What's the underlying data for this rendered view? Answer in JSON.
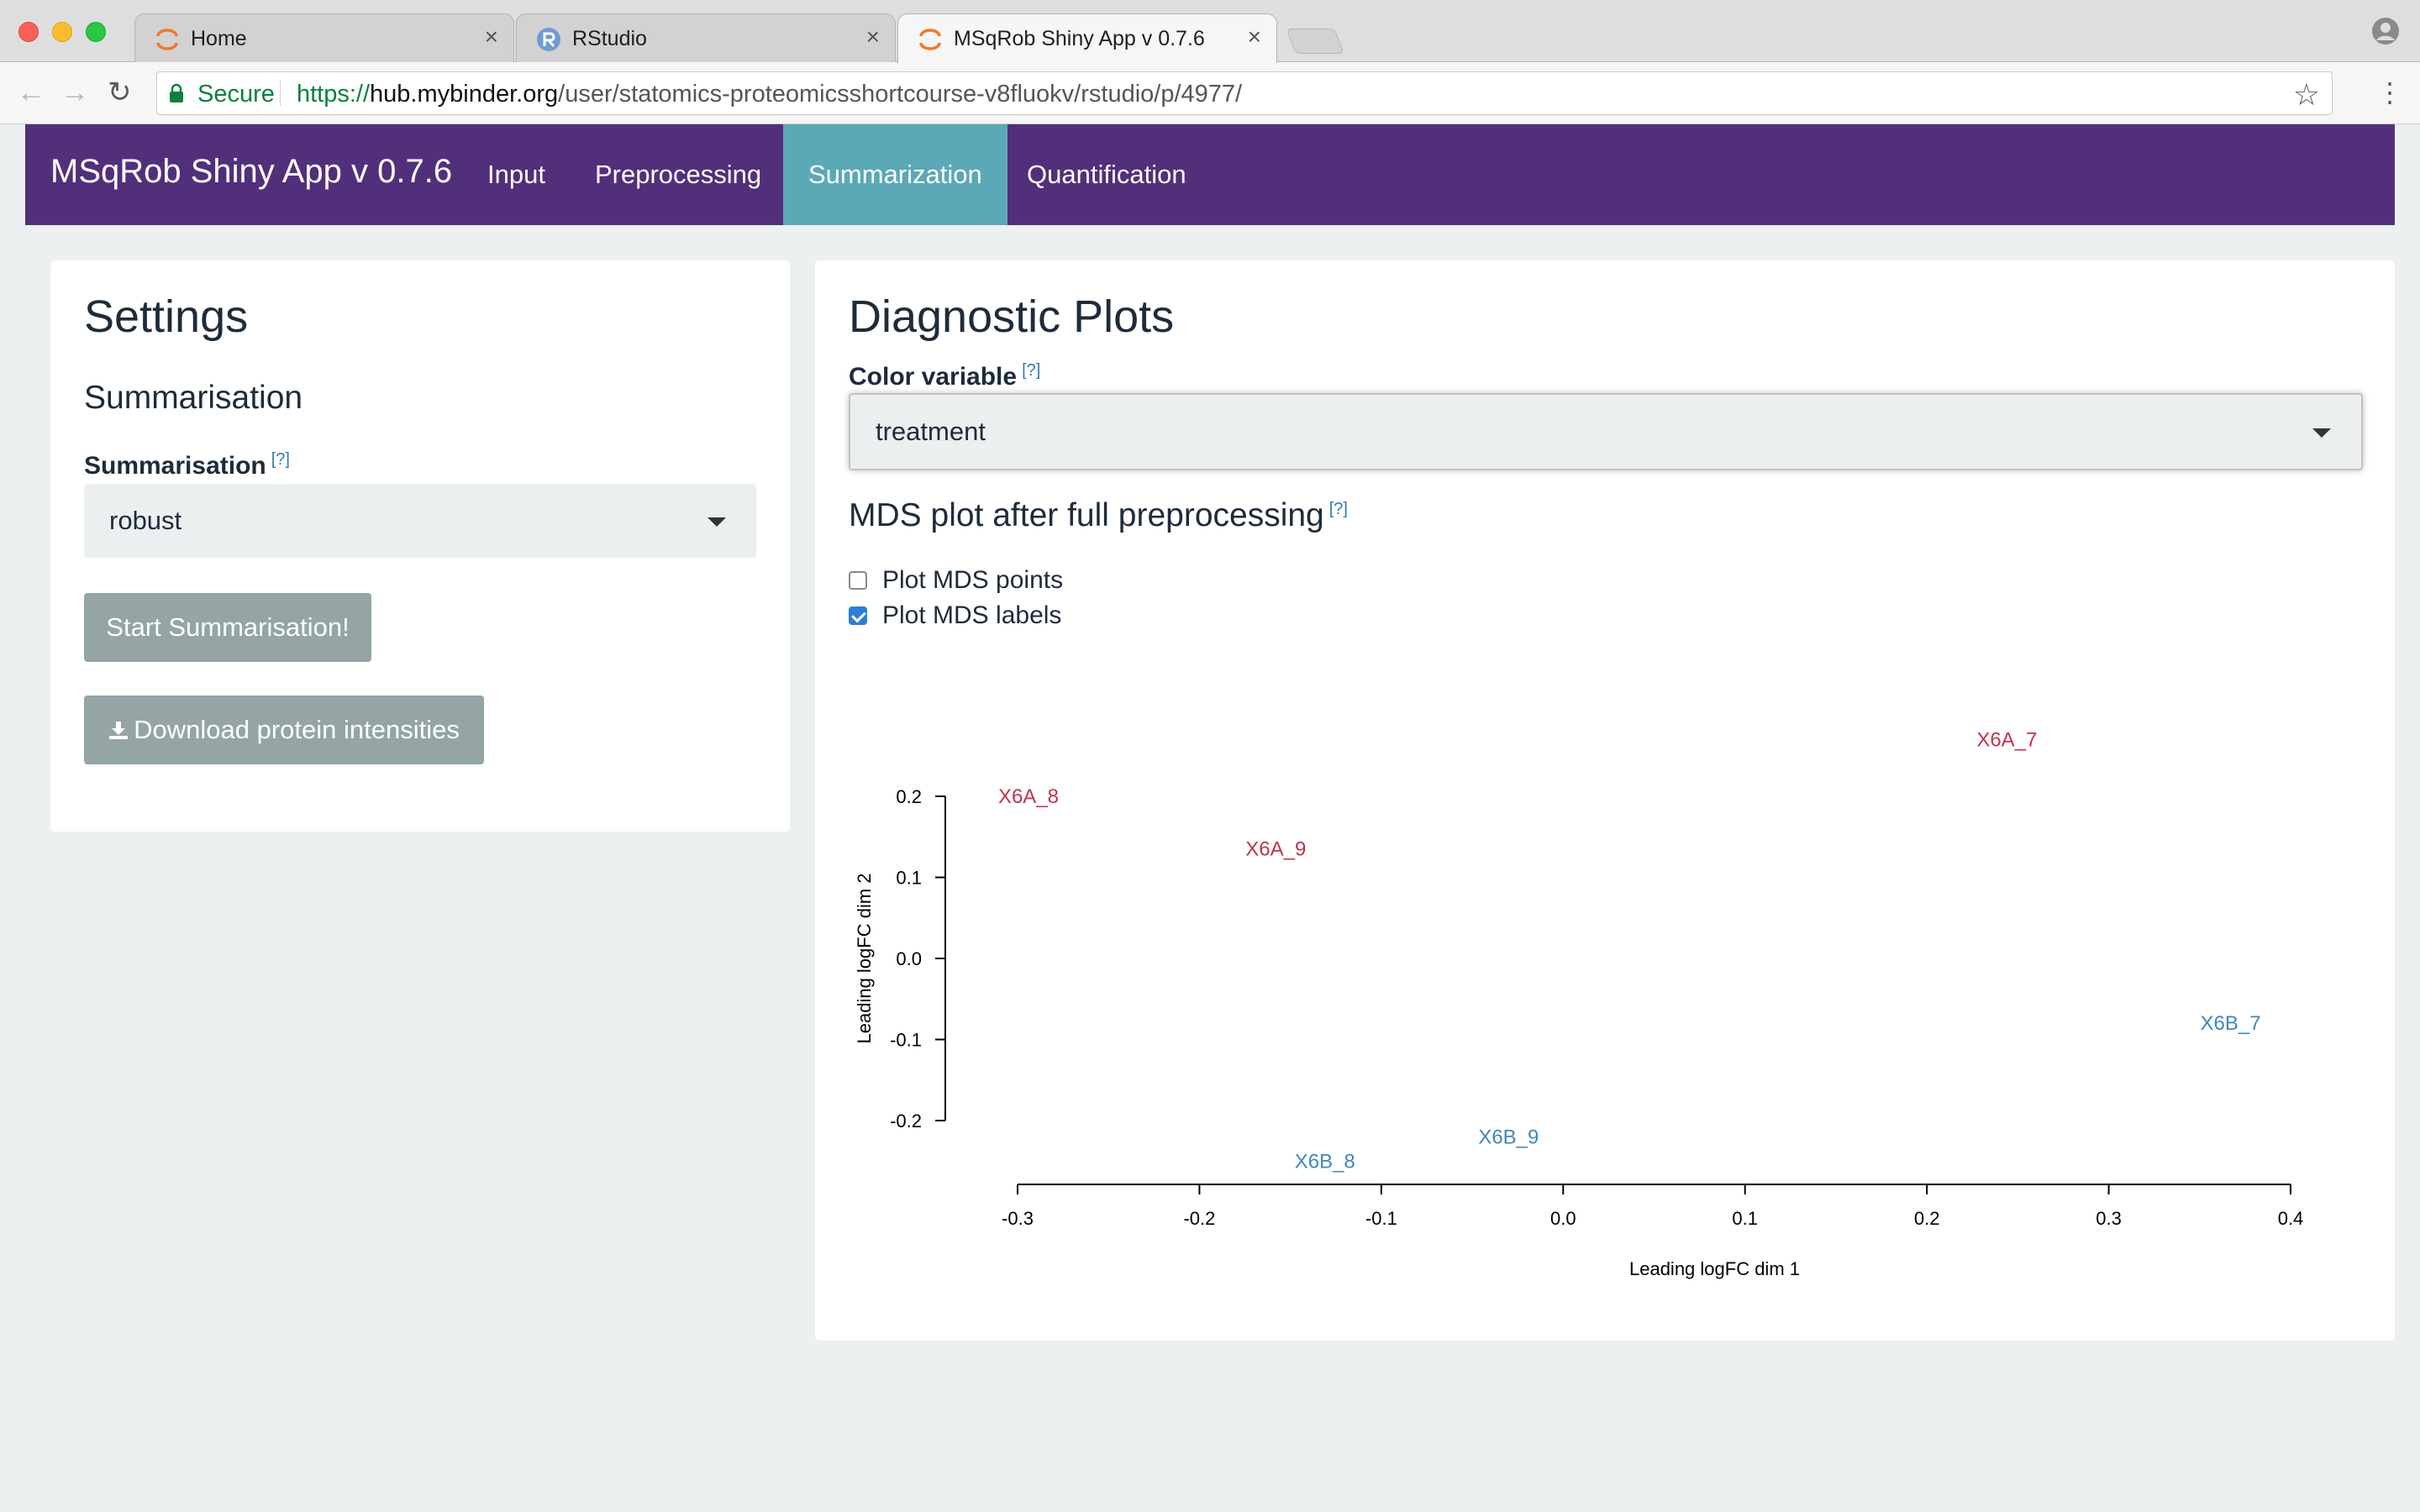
{
  "browser": {
    "tabs": [
      {
        "title": "Home",
        "icon": "jupyter-icon"
      },
      {
        "title": "RStudio",
        "icon": "rstudio-icon"
      },
      {
        "title": "MSqRob Shiny App v 0.7.6",
        "icon": "jupyter-icon",
        "active": true
      }
    ],
    "close_glyph": "×",
    "secure_label": "Secure",
    "url_scheme": "https://",
    "url_host": "hub.mybinder.org",
    "url_path": "/user/statomics-proteomicsshortcourse-v8fluokv/rstudio/p/4977/"
  },
  "navbar": {
    "brand": "MSqRob Shiny App v 0.7.6",
    "items": [
      "Input",
      "Preprocessing",
      "Summarization",
      "Quantification"
    ],
    "active": "Summarization"
  },
  "settings": {
    "title": "Settings",
    "section": "Summarisation",
    "summ_label": "Summarisation",
    "summ_value": "robust",
    "start_button": "Start Summarisation!",
    "download_button": "Download protein intensities"
  },
  "help_marker": "[?]",
  "diagnostics": {
    "title": "Diagnostic Plots",
    "color_label": "Color variable",
    "color_value": "treatment",
    "mds_title": "MDS plot after full preprocessing",
    "checkbox_points": {
      "label": "Plot MDS points",
      "checked": false
    },
    "checkbox_labels": {
      "label": "Plot MDS labels",
      "checked": true
    }
  },
  "chart_data": {
    "type": "scatter",
    "xlabel": "Leading logFC dim 1",
    "ylabel": "Leading logFC dim 2",
    "xticks": [
      "-0.3",
      "-0.2",
      "-0.1",
      "0.0",
      "0.1",
      "0.2",
      "0.3",
      "0.4"
    ],
    "yticks": [
      "-0.2",
      "-0.1",
      "0.0",
      "0.1",
      "0.2"
    ],
    "xlim": [
      -0.3,
      0.4
    ],
    "ylim": [
      -0.2,
      0.2
    ],
    "points": [
      {
        "label": "X6A_7",
        "x": 0.244,
        "y": 0.27,
        "group": "X6A"
      },
      {
        "label": "X6A_8",
        "x": -0.294,
        "y": 0.2,
        "group": "X6A"
      },
      {
        "label": "X6A_9",
        "x": -0.158,
        "y": 0.135,
        "group": "X6A"
      },
      {
        "label": "X6B_7",
        "x": 0.367,
        "y": -0.08,
        "group": "X6B"
      },
      {
        "label": "X6B_8",
        "x": -0.131,
        "y": -0.25,
        "group": "X6B"
      },
      {
        "label": "X6B_9",
        "x": -0.03,
        "y": -0.22,
        "group": "X6B"
      }
    ],
    "group_colors": {
      "X6A": "#c0334d",
      "X6B": "#3e86bf"
    }
  },
  "colors": {
    "navbar": "#522f7b",
    "active_tab": "#5ba8b6",
    "button": "#95a5a6"
  }
}
